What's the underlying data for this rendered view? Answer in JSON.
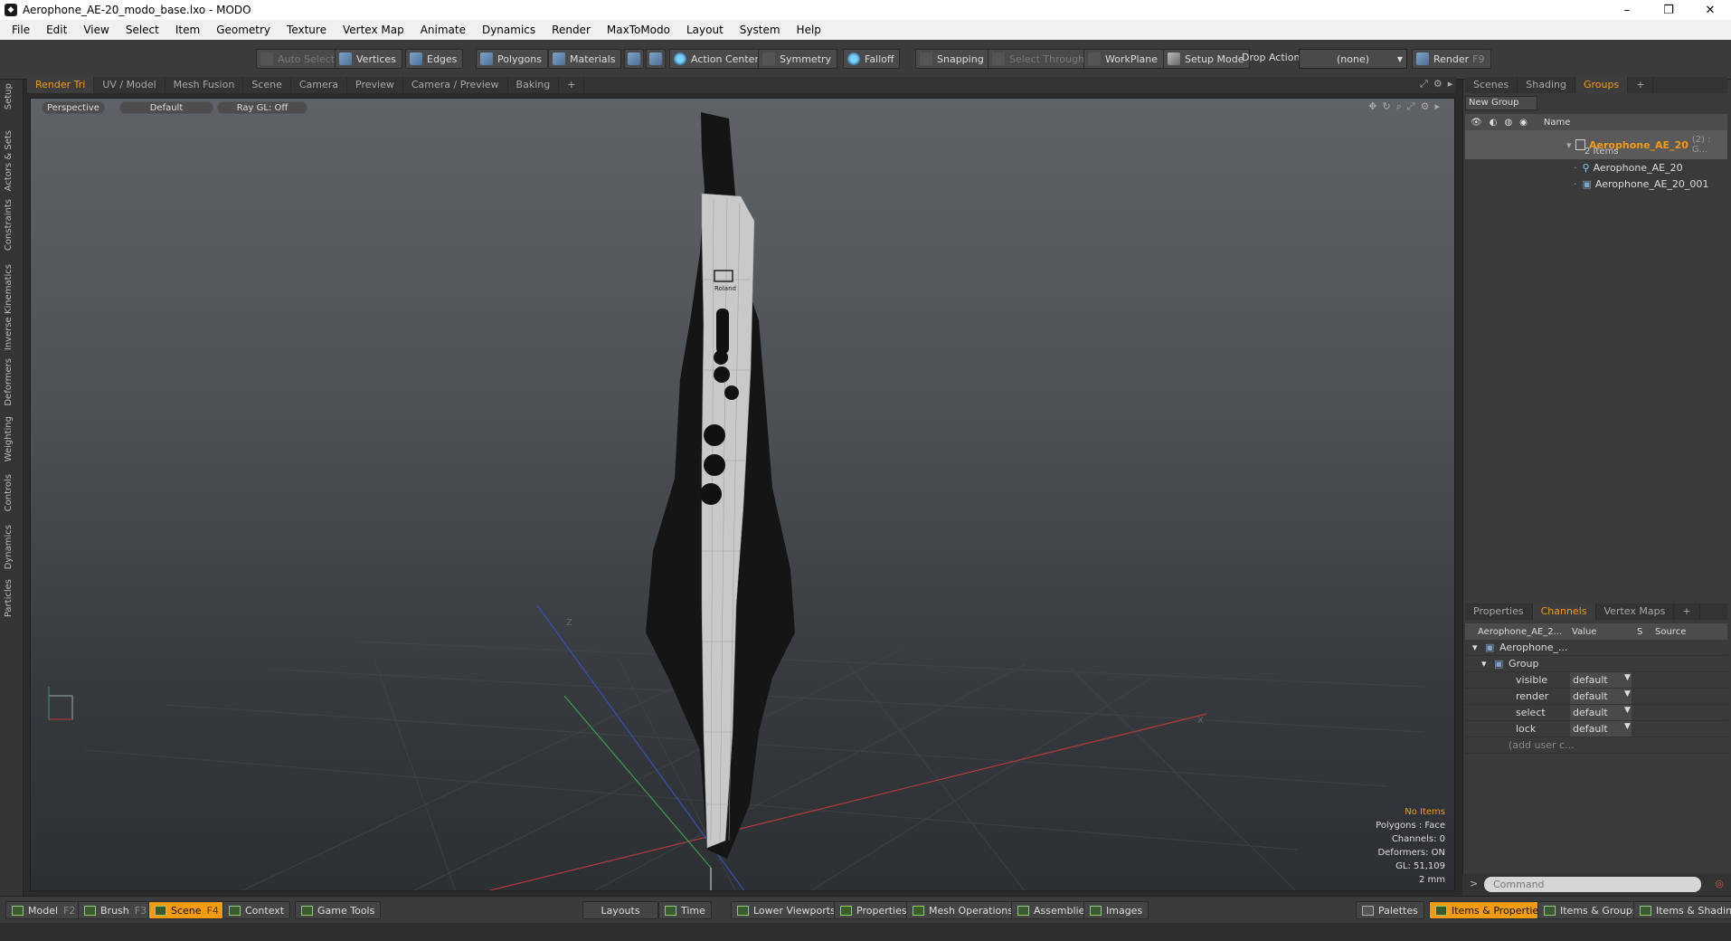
{
  "window": {
    "title": "Aerophone_AE-20_modo_base.lxo - MODO",
    "minimize": "–",
    "maximize": "❐",
    "close": "✕"
  },
  "menu": [
    "File",
    "Edit",
    "View",
    "Select",
    "Item",
    "Geometry",
    "Texture",
    "Vertex Map",
    "Animate",
    "Dynamics",
    "Render",
    "MaxToModo",
    "Layout",
    "System",
    "Help"
  ],
  "toolbar": {
    "auto_select": "Auto Select",
    "vertices": "Vertices",
    "edges": "Edges",
    "polygons": "Polygons",
    "materials": "Materials",
    "action_center": "Action Center",
    "symmetry": "Symmetry",
    "falloff": "Falloff",
    "snapping": "Snapping",
    "select_through": "Select Through",
    "workplane": "WorkPlane",
    "setup_mode": "Setup Mode",
    "drop_action_label": "Drop Action",
    "drop_action_value": "(none)",
    "render": "Render",
    "render_key": "F9"
  },
  "left_strip": [
    "Setup",
    "Actors & Sets",
    "Constraints",
    "Inverse Kinematics",
    "Deformers",
    "Weighting",
    "Controls",
    "Dynamics",
    "Particles"
  ],
  "viewport_tabs": [
    "Render Tri",
    "UV / Model",
    "Mesh Fusion",
    "Scene",
    "Camera",
    "Preview",
    "Camera / Preview",
    "Baking",
    "+"
  ],
  "viewport": {
    "perspective": "Perspective",
    "default": "Default",
    "raygl": "Ray GL: Off",
    "info": {
      "no_items": "No Items",
      "polygons": "Polygons : Face",
      "channels": "Channels: 0",
      "deformers": "Deformers: ON",
      "gl": "GL: 51,109",
      "scale": "2 mm"
    },
    "logo_text": "Roland",
    "axis_z": "Z",
    "axis_x": "X"
  },
  "scene_tabs": [
    "Scenes",
    "Shading",
    "Groups",
    "+"
  ],
  "groups": {
    "new_group": "New Group",
    "name_header": "Name",
    "root": "Aerophone_AE_20",
    "root_suffix": "(2) : G...",
    "items_count": "2 Items",
    "children": [
      "Aerophone_AE_20",
      "Aerophone_AE_20_001"
    ]
  },
  "props_tabs": [
    "Properties",
    "Channels",
    "Vertex Maps",
    "+"
  ],
  "channels": {
    "col_name": "Aerophone_AE_2...",
    "col_value": "Value",
    "col_s": "S",
    "col_source": "Source",
    "item": "Aerophone_...",
    "group": "Group",
    "rows": [
      {
        "name": "visible",
        "value": "default"
      },
      {
        "name": "render",
        "value": "default"
      },
      {
        "name": "select",
        "value": "default"
      },
      {
        "name": "lock",
        "value": "default"
      }
    ],
    "add_user": "(add user c..."
  },
  "command": {
    "prompt": ">",
    "placeholder": "Command"
  },
  "bottom": {
    "model": "Model",
    "model_key": "F2",
    "brush": "Brush",
    "brush_key": "F3",
    "scene": "Scene",
    "scene_key": "F4",
    "context": "Context",
    "game_tools": "Game Tools",
    "layouts": "Layouts",
    "time": "Time",
    "lower_viewports": "Lower Viewports",
    "properties": "Properties",
    "mesh_operations": "Mesh Operations",
    "assemblies": "Assemblies",
    "images": "Images",
    "palettes": "Palettes",
    "items_properties": "Items & Properties",
    "items_groups": "Items & Groups",
    "items_shading": "Items & Shading"
  }
}
